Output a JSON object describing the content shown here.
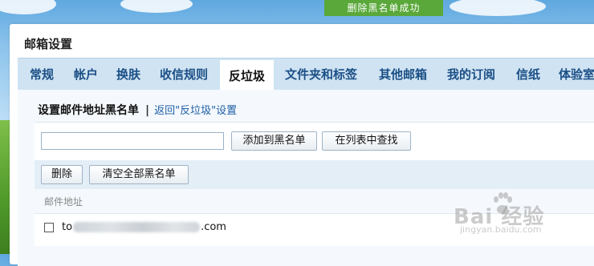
{
  "toast": {
    "text": "删除黑名单成功"
  },
  "panel": {
    "title": "邮箱设置"
  },
  "tabs": [
    {
      "label": "常规"
    },
    {
      "label": "帐户"
    },
    {
      "label": "换肤"
    },
    {
      "label": "收信规则"
    },
    {
      "label": "反垃圾",
      "active": true
    },
    {
      "label": "文件夹和标签"
    },
    {
      "label": "其他邮箱"
    },
    {
      "label": "我的订阅"
    },
    {
      "label": "信纸"
    },
    {
      "label": "体验室"
    }
  ],
  "section": {
    "title": "设置邮件地址黑名单",
    "separator": "|",
    "back_link": "返回\"反垃圾\"设置"
  },
  "toolbar": {
    "input_value": "",
    "add_button": "添加到黑名单",
    "find_button": "在列表中查找"
  },
  "actions": {
    "delete_button": "删除",
    "clear_all_button": "清空全部黑名单"
  },
  "list": {
    "column_header": "邮件地址",
    "rows": [
      {
        "email_prefix": "to",
        "email_suffix": ".com",
        "checked": false
      }
    ]
  },
  "watermark": {
    "brand": "Bai 经验",
    "url": "jingyan.baidu.com"
  }
}
